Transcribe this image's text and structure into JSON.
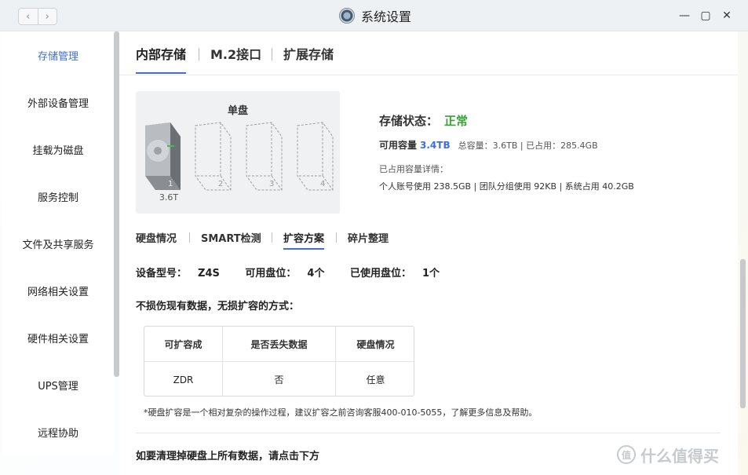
{
  "window": {
    "title": "系统设置",
    "back_icon": "‹",
    "forward_icon": "›",
    "minimize_icon": "—",
    "maximize_icon": "▢",
    "close_icon": "✕"
  },
  "sidebar": {
    "items": [
      {
        "label": "存储管理",
        "active": true
      },
      {
        "label": "外部设备管理"
      },
      {
        "label": "挂载为磁盘"
      },
      {
        "label": "服务控制"
      },
      {
        "label": "文件及共享服务"
      },
      {
        "label": "网络相关设置"
      },
      {
        "label": "硬件相关设置"
      },
      {
        "label": "UPS管理"
      },
      {
        "label": "远程协助"
      }
    ]
  },
  "tabs": [
    {
      "label": "内部存储",
      "active": true
    },
    {
      "label": "M.2接口"
    },
    {
      "label": "扩展存储"
    }
  ],
  "disk_card": {
    "title": "单盘",
    "slots": [
      "1",
      "2",
      "3",
      "4"
    ],
    "installed_size": "3.6T"
  },
  "status": {
    "label": "存储状态：",
    "value": "正常",
    "available_label": "可用容量",
    "available_value": "3.4TB",
    "detail": "总容量：3.6TB | 已占用：285.4GB",
    "used_title": "已占用容量详情：",
    "used_detail": "个人账号使用 238.5GB | 团队分组使用 92KB | 系统占用 40.2GB"
  },
  "subtabs": [
    {
      "label": "硬盘情况"
    },
    {
      "label": "SMART检测"
    },
    {
      "label": "扩容方案",
      "active": true
    },
    {
      "label": "碎片整理"
    }
  ],
  "device": {
    "model_label": "设备型号：",
    "model_value": "Z4S",
    "available_slots_label": "可用盘位：",
    "available_slots_value": "4个",
    "used_slots_label": "已使用盘位：",
    "used_slots_value": "1个"
  },
  "expansion": {
    "description": "不损伤现有数据，无损扩容的方式：",
    "headers": [
      "可扩容成",
      "是否丢失数据",
      "硬盘情况"
    ],
    "row": [
      "ZDR",
      "否",
      "任意"
    ],
    "note": "*硬盘扩容是一个相对复杂的操作过程，建议扩容之前咨询客服400-010-5055，了解更多信息及帮助。",
    "clear_text": "如要清理掉硬盘上所有数据，请点击下方"
  },
  "watermark": {
    "logo_text": "值",
    "text": "什么值得买"
  },
  "colors": {
    "accent": "#3e6fd8",
    "status_ok": "#37a337",
    "disk_led": "#36c25b"
  }
}
